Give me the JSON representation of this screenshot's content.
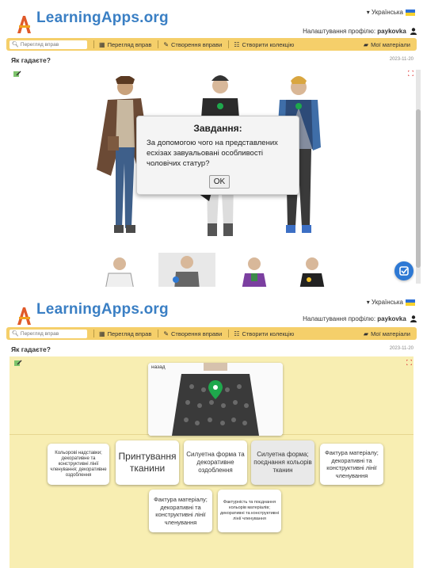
{
  "header": {
    "logo": "LearningApps.org",
    "language": "Українська",
    "profile_label": "Налаштування профілю:",
    "username": "paykovka"
  },
  "nav": {
    "search_placeholder": "Перегляд вправ",
    "browse": "Перегляд вправ",
    "create_exercise": "Створення вправи",
    "create_collection": "Створити колекцію",
    "my_materials": "Мої матеріали"
  },
  "page": {
    "title": "Як гадаєте?",
    "date": "2023-11-20"
  },
  "dialog": {
    "title": "Завдання:",
    "text": "За допомогою чого на представлених есхізах завуальовані особливості чоловічих статур?",
    "ok": "OK"
  },
  "matching": {
    "back_label": "назад",
    "cards": [
      "Кольорові надставки; декоративне та конструктивні лінії членування; декоративне оздоблення",
      "Принтування тканини",
      "Силуетна форма та декоративне оздоблення",
      "Силуетна форма; поєднання кольорів тканин",
      "Фактура матеріалу; декоративні та конструктивні лінії членування",
      "Фактура матеріалу; декоративні та конструктивні лінії членування",
      "Фактурність та поєднання кольорів матеріалів; декоративні та конструктивні лінії членування"
    ]
  },
  "colors": {
    "accent": "#2e79d4",
    "navbar": "#f5cf6a",
    "paper": "#f8eeb2",
    "logo": "#3a7fc4",
    "pin": "#1ea84c"
  },
  "icons": {
    "edit": "edit-fab-icon",
    "fullscreen": "fullscreen-icon",
    "pin": "map-pin-icon"
  }
}
